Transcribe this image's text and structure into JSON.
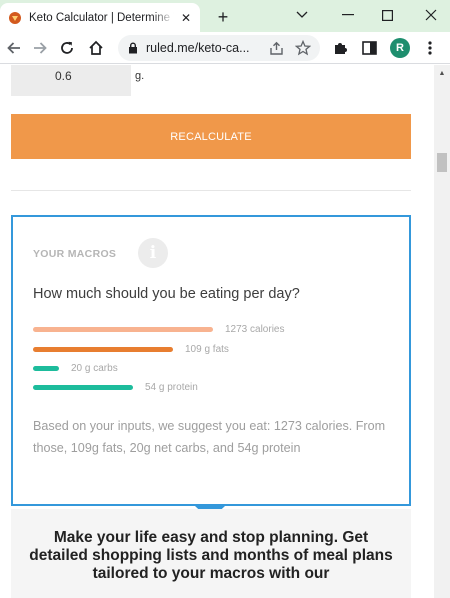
{
  "browser": {
    "tab_title": "Keto Calculator | Determine Your",
    "url": "ruled.me/keto-ca...",
    "profile_initial": "R"
  },
  "page": {
    "input_value": "0.6",
    "input_unit": "g.",
    "recalculate_label": "RECALCULATE",
    "macros_heading": "YOUR MACROS",
    "macros_question": "How much should you be eating per day?",
    "macros": [
      {
        "label": "1273 calories",
        "color": "#f8b390",
        "bar_fraction": 1.0
      },
      {
        "label": "109 g fats",
        "color": "#e87e30",
        "bar_fraction": 0.775
      },
      {
        "label": "20 g carbs",
        "color": "#1dbc9c",
        "bar_fraction": 0.145
      },
      {
        "label": "54 g protein",
        "color": "#1dbc9c",
        "bar_fraction": 0.555
      }
    ],
    "summary": "Based on your inputs, we suggest you eat: 1273 calories. From those, 109g fats, 20g net carbs, and 54g protein",
    "promo": "Make your life easy and stop planning. Get detailed shopping lists and months of meal plans tailored to your macros with our"
  },
  "colors": {
    "accent_orange": "#f0984a",
    "card_border": "#3498db"
  }
}
